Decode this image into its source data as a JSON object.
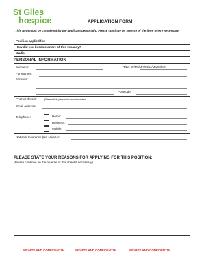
{
  "logo": {
    "line1": "St Giles",
    "line2": "hospice"
  },
  "form": {
    "title": "APPLICATION FORM",
    "instructions": "This form must be completed by the applicant personally. Please continue on reverse of the form where necessary."
  },
  "vacancy": {
    "position_label": "Position applied for:",
    "aware_label": "How did you become aware of this vacancy?",
    "media_label": "Media:"
  },
  "personal": {
    "heading": "PERSONAL INFORMATION",
    "surname_label": "Surname:",
    "title_label": "Title: Dr/Mr/Mrs/Miss/Ms/Other:",
    "forenames_label": "Forenames:",
    "address_label": "Address:",
    "postcode_label": "Postcode:",
    "contact_label": "Contact details:",
    "contact_note": "(Please tick preferred contact number)",
    "email_label": "Email address:",
    "telephone_label": "Telephone:",
    "home_label": "Home:",
    "business_label": "Business:",
    "mobile_label": "Mobile:",
    "ni_label": "National Insurance (NI) Number:"
  },
  "reasons": {
    "heading": "PLEASE STATE YOUR REASONS FOR APPLYING FOR THIS POSITION:",
    "note": "(Please continue on the reverse of this sheet if necessary)"
  },
  "footer": {
    "left": "PRIVATE AND CONFIDENTIAL",
    "center": "PRIVATE AND CONFIDENTIAL",
    "right": "PRIVATE AND CONFIDENTIAL"
  },
  "colors": {
    "brand_green": "#6db33f",
    "footer_red": "#d62b2b"
  }
}
